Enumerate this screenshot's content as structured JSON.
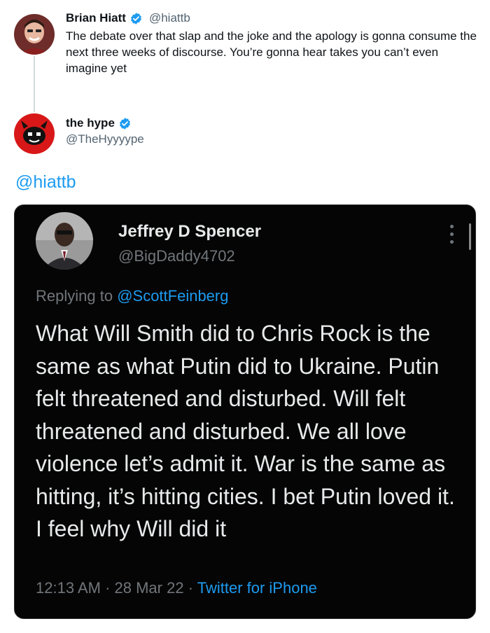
{
  "colors": {
    "link_blue": "#1d9bf0",
    "text_dark": "#0f1419",
    "text_muted": "#536471",
    "embed_bg": "#050505"
  },
  "tweet_main": {
    "name": "Brian Hiatt",
    "handle": "@hiattb",
    "text": "The debate over that slap and the joke and the apology is gonna consume the next three weeks of discourse. You’re gonna hear takes you can’t even imagine yet",
    "avatar_icon": "person-avatar-icon",
    "verified_icon": "verified-badge-icon"
  },
  "tweet_reply": {
    "name": "the hype",
    "handle": "@TheHyyyype",
    "avatar_icon": "devil-logo-icon",
    "verified_icon": "verified-badge-icon",
    "mention": "@hiattb"
  },
  "embedded_tweet": {
    "name": "Jeffrey D Spencer",
    "handle": "@BigDaddy4702",
    "replying_prefix": "Replying to ",
    "replying_to": "@ScottFeinberg",
    "text": "What Will Smith did to Chris Rock is the same as what Putin did to Ukraine. Putin felt threatened and disturbed. Will felt threatened and disturbed. We all love violence let’s admit it. War is the same as hitting, it’s hitting cities. I bet Putin loved it. I feel why Will did it",
    "time": "12:13 AM",
    "sep1": " · ",
    "date": "28 Mar 22",
    "sep2": " · ",
    "source": "Twitter for iPhone",
    "more_icon": "more-options-icon"
  }
}
